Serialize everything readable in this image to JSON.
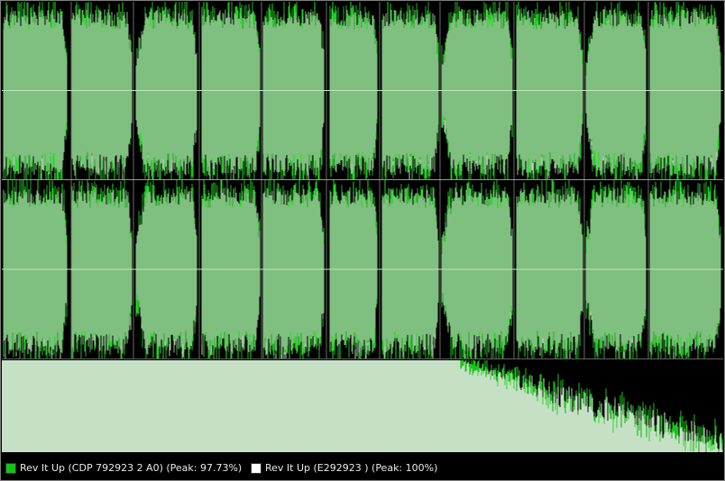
{
  "colors": {
    "background": "#000000",
    "envelope_fill": "#7fbf7f",
    "envelope_edge": "#2aa82a",
    "envelope_bright": "#19e019",
    "overlay_peaks": "#c9c9c9",
    "centerline": "#bfe6bf",
    "spectrum_fill": "#d6f3d6",
    "spectrum_edge": "#1fc21f"
  },
  "waveform": {
    "channels": [
      "left",
      "right"
    ],
    "segments": 11
  },
  "legend": {
    "items": [
      {
        "label": "Rev It Up (CDP 792923 2 A0) (Peak: 97.73%)",
        "swatch_color": "#19c019"
      },
      {
        "label": "Rev It Up (E292923 ) (Peak: 100%)",
        "swatch_color": "#ffffff"
      }
    ]
  }
}
